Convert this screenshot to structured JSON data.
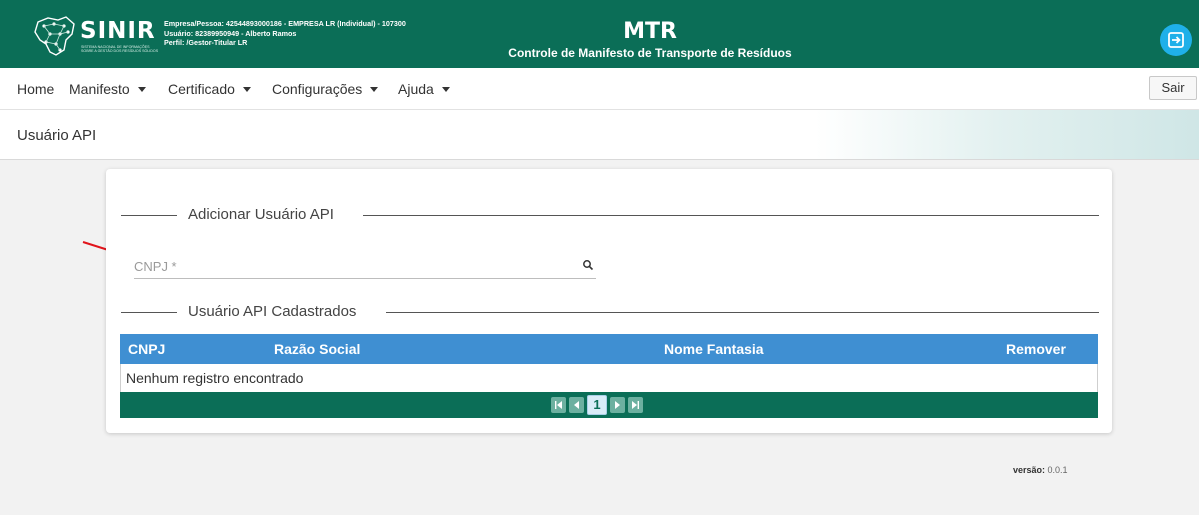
{
  "header": {
    "brand": "SINIR",
    "brand_subtitle": "Sistema Nacional de Informações sobre a Gestão dos Resíduos Sólidos",
    "company_line": "Empresa/Pessoa: 42544893000186 - EMPRESA LR (Individual) - 107300",
    "user_line": "Usuário: 82389950949 - Alberto Ramos",
    "profile_line": "Perfil: /Gestor-Titular LR",
    "title": "MTR",
    "subtitle": "Controle de Manifesto de Transporte de Resíduos",
    "exit_icon": "logout-icon",
    "exit_icon_color": "#1fb0e9",
    "brand_color": "#0b6e57"
  },
  "menu": {
    "items": [
      "Home",
      "Manifesto",
      "Certificado",
      "Configurações",
      "Ajuda"
    ],
    "logout_label": "Sair"
  },
  "page": {
    "title": "Usuário API"
  },
  "add_section": {
    "legend": "Adicionar Usuário API",
    "cnpj_placeholder": "CNPJ *",
    "cnpj_value": ""
  },
  "list_section": {
    "legend": "Usuário API Cadastrados",
    "columns": [
      "CNPJ",
      "Razão Social",
      "Nome Fantasia",
      "Remover"
    ],
    "empty_message": "Nenhum registro encontrado",
    "header_color": "#3f8fd2",
    "pagination": {
      "current_page": "1"
    }
  },
  "footer": {
    "version_label": "versão:",
    "version_value": "0.0.1"
  }
}
